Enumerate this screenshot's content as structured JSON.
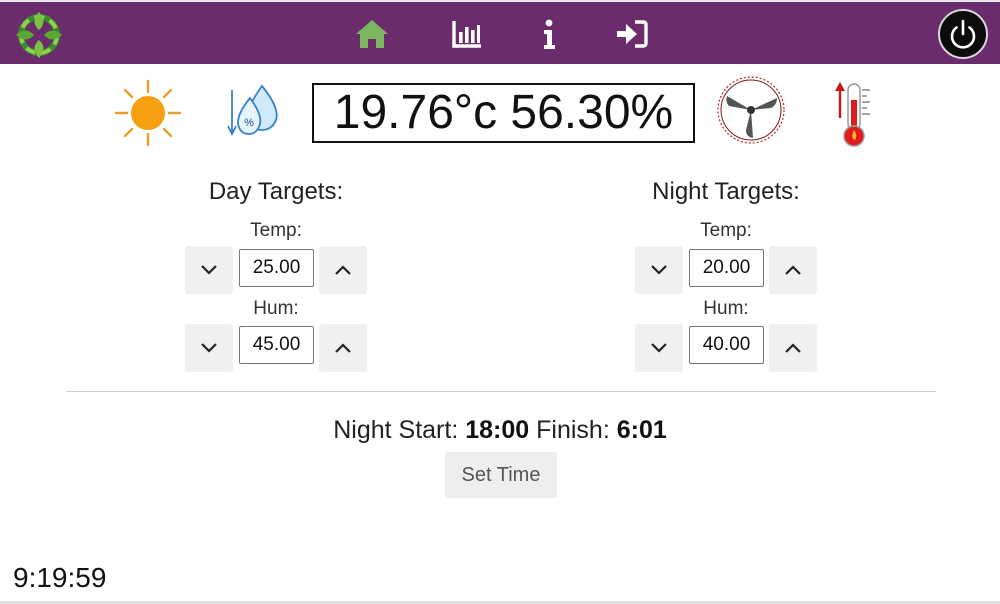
{
  "nav": {
    "icons": [
      "leaf-ring-logo",
      "home-icon",
      "chart-icon",
      "info-icon",
      "sign-in-icon",
      "power-icon"
    ],
    "colors": {
      "bar": "#6a2c6c",
      "home_active": "#7bb661"
    }
  },
  "status": {
    "readout": "19.76°c 56.30%",
    "icons": [
      "sun-icon",
      "humidity-drops-icon",
      "fan-icon",
      "thermometer-icon"
    ]
  },
  "day": {
    "title": "Day Targets:",
    "temp_label": "Temp:",
    "temp_value": "25.00",
    "hum_label": "Hum:",
    "hum_value": "45.00"
  },
  "night": {
    "title": "Night Targets:",
    "temp_label": "Temp:",
    "temp_value": "20.00",
    "hum_label": "Hum:",
    "hum_value": "40.00"
  },
  "schedule": {
    "start_label": "Night Start:",
    "start_value": "18:00",
    "finish_label": "Finish:",
    "finish_value": "6:01",
    "set_button": "Set Time"
  },
  "clock": "9:19:59"
}
